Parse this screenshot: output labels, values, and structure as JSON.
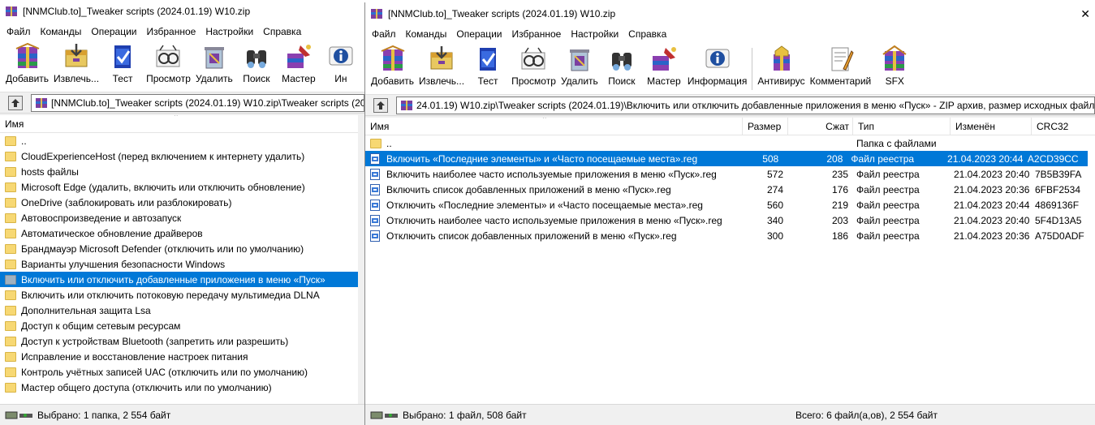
{
  "colors": {
    "selection": "#0078d7",
    "folder": "#f7d873",
    "window_bg": "#f0f0f0"
  },
  "left": {
    "title": "[NNMClub.to]_Tweaker scripts (2024.01.19) W10.zip",
    "menu": [
      "Файл",
      "Команды",
      "Операции",
      "Избранное",
      "Настройки",
      "Справка"
    ],
    "tools": [
      {
        "label": "Добавить",
        "icon": "add-archive-icon"
      },
      {
        "label": "Извлечь...",
        "icon": "extract-icon"
      },
      {
        "label": "Тест",
        "icon": "test-icon"
      },
      {
        "label": "Просмотр",
        "icon": "view-icon"
      },
      {
        "label": "Удалить",
        "icon": "delete-icon"
      },
      {
        "label": "Поиск",
        "icon": "find-icon"
      },
      {
        "label": "Мастер",
        "icon": "wizard-icon"
      },
      {
        "label": "Ин",
        "icon": "info-icon"
      }
    ],
    "address": "[NNMClub.to]_Tweaker scripts (2024.01.19) W10.zip\\Tweaker scripts (20",
    "column_name": "Имя",
    "items": [
      "..",
      "CloudExperienceHost (перед включением к интернету удалить)",
      "hosts файлы",
      "Microsoft Edge (удалить, включить или отключить обновление)",
      "OneDrive (заблокировать или разблокировать)",
      "Автовоспроизведение и автозапуск",
      "Автоматическое обновление драйверов",
      "Брандмауэр Microsoft Defender (отключить или по умолчанию)",
      "Варианты улучшения безопасности Windows",
      "Включить или отключить добавленные приложения в меню «Пуск»",
      "Включить или отключить потоковую передачу мультимедиа DLNA",
      "Дополнительная защита Lsa",
      "Доступ к общим сетевым ресурсам",
      "Доступ к устройствам Bluetooth (запретить или разрешить)",
      "Исправление и восстановление настроек питания",
      "Контроль учётных записей UAC (отключить или по умолчанию)",
      "Мастер общего доступа (отключить или по умолчанию)"
    ],
    "selected_index": 9,
    "status": "Выбрано: 1 папка, 2 554 байт"
  },
  "right": {
    "title": "[NNMClub.to]_Tweaker scripts (2024.01.19) W10.zip",
    "close": "✕",
    "menu": [
      "Файл",
      "Команды",
      "Операции",
      "Избранное",
      "Настройки",
      "Справка"
    ],
    "tools": [
      {
        "label": "Добавить",
        "icon": "add-archive-icon"
      },
      {
        "label": "Извлечь...",
        "icon": "extract-icon"
      },
      {
        "label": "Тест",
        "icon": "test-icon"
      },
      {
        "label": "Просмотр",
        "icon": "view-icon"
      },
      {
        "label": "Удалить",
        "icon": "delete-icon"
      },
      {
        "label": "Поиск",
        "icon": "find-icon"
      },
      {
        "label": "Мастер",
        "icon": "wizard-icon"
      },
      {
        "label": "Информация",
        "icon": "info-icon"
      },
      {
        "label": "Антивирус",
        "icon": "antivirus-icon"
      },
      {
        "label": "Комментарий",
        "icon": "comment-icon"
      },
      {
        "label": "SFX",
        "icon": "sfx-icon"
      }
    ],
    "address": "24.01.19) W10.zip\\Tweaker scripts (2024.01.19)\\Включить или отключить добавленные приложения в меню «Пуск» - ZIP архив, размер исходных файлов",
    "columns": [
      "Имя",
      "Размер",
      "Сжат",
      "Тип",
      "Изменён",
      "CRC32"
    ],
    "parent": {
      "name": "..",
      "type": "Папка с файлами"
    },
    "files": [
      {
        "name": "Включить «Последние элементы» и «Часто посещаемые места».reg",
        "size": "508",
        "packed": "208",
        "type": "Файл реестра",
        "modified": "21.04.2023 20:44",
        "crc": "A2CD39CC"
      },
      {
        "name": "Включить наиболее часто используемые приложения в меню «Пуск».reg",
        "size": "572",
        "packed": "235",
        "type": "Файл реестра",
        "modified": "21.04.2023 20:40",
        "crc": "7B5B39FA"
      },
      {
        "name": "Включить список добавленных приложений в меню «Пуск».reg",
        "size": "274",
        "packed": "176",
        "type": "Файл реестра",
        "modified": "21.04.2023 20:36",
        "crc": "6FBF2534"
      },
      {
        "name": "Отключить «Последние элементы» и «Часто посещаемые места».reg",
        "size": "560",
        "packed": "219",
        "type": "Файл реестра",
        "modified": "21.04.2023 20:44",
        "crc": "4869136F"
      },
      {
        "name": "Отключить наиболее часто используемые приложения в меню «Пуск».reg",
        "size": "340",
        "packed": "203",
        "type": "Файл реестра",
        "modified": "21.04.2023 20:40",
        "crc": "5F4D13A5"
      },
      {
        "name": "Отключить список добавленных приложений в меню «Пуск».reg",
        "size": "300",
        "packed": "186",
        "type": "Файл реестра",
        "modified": "21.04.2023 20:36",
        "crc": "A75D0ADF"
      }
    ],
    "selected_index": 0,
    "status_left": "Выбрано: 1 файл, 508 байт",
    "status_right": "Всего: 6 файл(а,ов), 2 554 байт"
  }
}
